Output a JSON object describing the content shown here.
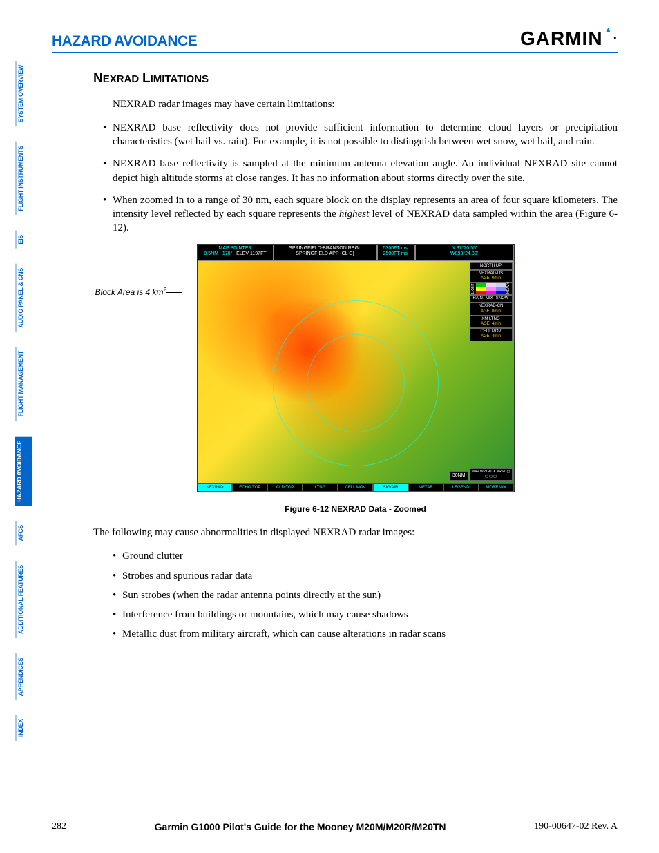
{
  "header": {
    "section": "HAZARD AVOIDANCE",
    "brand": "GARMIN"
  },
  "sidebar": {
    "tabs": [
      "SYSTEM OVERVIEW",
      "FLIGHT INSTRUMENTS",
      "EIS",
      "AUDIO PANEL & CNS",
      "FLIGHT MANAGEMENT",
      "HAZARD AVOIDANCE",
      "AFCS",
      "ADDITIONAL FEATURES",
      "APPENDICES",
      "INDEX"
    ],
    "active_index": 5
  },
  "content": {
    "subheading": "Nexrad Limitations",
    "intro": "NEXRAD radar images may have certain limitations:",
    "bullets": [
      "NEXRAD base reflectivity does not provide sufficient information to determine cloud layers or precipitation characteristics (wet hail vs. rain).  For example, it is not possible to distinguish between wet snow, wet hail, and rain.",
      "NEXRAD base reflectivity is sampled at the minimum antenna elevation angle.  An individual NEXRAD site cannot depict high altitude storms at close ranges.  It has no information about storms directly over the site.",
      "When zoomed in to a range of 30 nm, each square block on the display represents an area of four square kilometers.  The intensity level reflected by each square represents the highest level of NEXRAD data sampled within the area (Figure 6-12)."
    ],
    "callout": "Block Area is 4 km",
    "figure_caption": "Figure 6-12  NEXRAD Data - Zoomed",
    "abnormal_intro": "The following may cause abnormalities in displayed NEXRAD radar images:",
    "abnormal_list": [
      "Ground clutter",
      "Strobes and spurious radar data",
      "Sun strobes (when the radar antenna points directly at the sun)",
      "Interference from buildings or mountains, which may cause shadows",
      "Metallic dust from military aircraft, which can cause alterations in radar scans"
    ]
  },
  "map": {
    "top_left": {
      "l1": "MAP POINTER",
      "l2a": "0.5NM",
      "l2b": "170°",
      "l2c": "ELEV   1197FT"
    },
    "top_mid": {
      "l1": "SPRINGFIELD-BRANSON REGL",
      "l2": "SPRINGFIELD APP (CL C)"
    },
    "top_right1": {
      "l1": "5300FT msl",
      "l2": "2500FT msl"
    },
    "top_right2": {
      "l1": "N 37°20.55'",
      "l2": "W093°24.30'"
    },
    "legend": {
      "north": "NORTH UP",
      "nexrad_us": "NEXRAD-US",
      "age1": "AGE: 0min",
      "rain": "RAIN",
      "mix": "MIX",
      "snow": "SNOW",
      "light": "LIGHT",
      "heavy": "HEAVY",
      "nexrad_cn": "NEXRAD-CN",
      "age2": "AGE: 0min",
      "xm": "XM LTNG",
      "age3": "AGE: 4min",
      "cell": "CELL MOV",
      "age4": "AGE: 4min"
    },
    "scale": "30NM",
    "wpt": "MAP WPT AUX NRST ▢ ▢ ▢ ▢",
    "bottom_buttons": [
      "NEXRAD",
      "ECHO TOP",
      "CLD TOP",
      "LTNG",
      "CELL MOV",
      "SIG/AIR",
      "METAR",
      "LEGEND",
      "MORE WX"
    ]
  },
  "footer": {
    "page": "282",
    "title": "Garmin G1000 Pilot's Guide for the Mooney M20M/M20R/M20TN",
    "doc": "190-00647-02  Rev. A"
  }
}
